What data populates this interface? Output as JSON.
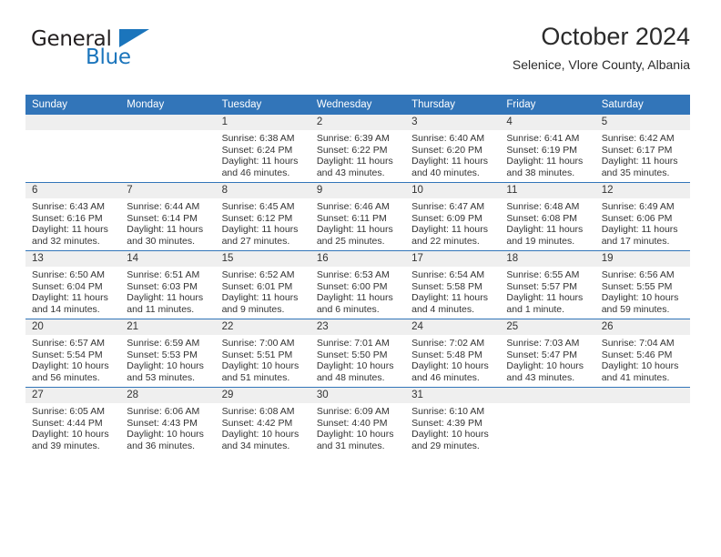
{
  "brand": {
    "name_dark": "General",
    "name_blue": "Blue",
    "accent_color": "#1b75bc"
  },
  "header": {
    "title": "October 2024",
    "subtitle": "Selenice, Vlore County, Albania"
  },
  "theme": {
    "header_row_bg": "#3275b9",
    "daynum_bg": "#efefef",
    "text": "#333333"
  },
  "calendar": {
    "weekday_headers": [
      "Sunday",
      "Monday",
      "Tuesday",
      "Wednesday",
      "Thursday",
      "Friday",
      "Saturday"
    ],
    "labels": {
      "sunrise": "Sunrise:",
      "sunset": "Sunset:",
      "daylight": "Daylight:"
    },
    "weeks": [
      [
        {
          "day": "",
          "empty": true
        },
        {
          "day": "",
          "empty": true
        },
        {
          "day": "1",
          "sunrise": "Sunrise: 6:38 AM",
          "sunset": "Sunset: 6:24 PM",
          "daylight": "Daylight: 11 hours and 46 minutes."
        },
        {
          "day": "2",
          "sunrise": "Sunrise: 6:39 AM",
          "sunset": "Sunset: 6:22 PM",
          "daylight": "Daylight: 11 hours and 43 minutes."
        },
        {
          "day": "3",
          "sunrise": "Sunrise: 6:40 AM",
          "sunset": "Sunset: 6:20 PM",
          "daylight": "Daylight: 11 hours and 40 minutes."
        },
        {
          "day": "4",
          "sunrise": "Sunrise: 6:41 AM",
          "sunset": "Sunset: 6:19 PM",
          "daylight": "Daylight: 11 hours and 38 minutes."
        },
        {
          "day": "5",
          "sunrise": "Sunrise: 6:42 AM",
          "sunset": "Sunset: 6:17 PM",
          "daylight": "Daylight: 11 hours and 35 minutes."
        }
      ],
      [
        {
          "day": "6",
          "sunrise": "Sunrise: 6:43 AM",
          "sunset": "Sunset: 6:16 PM",
          "daylight": "Daylight: 11 hours and 32 minutes."
        },
        {
          "day": "7",
          "sunrise": "Sunrise: 6:44 AM",
          "sunset": "Sunset: 6:14 PM",
          "daylight": "Daylight: 11 hours and 30 minutes."
        },
        {
          "day": "8",
          "sunrise": "Sunrise: 6:45 AM",
          "sunset": "Sunset: 6:12 PM",
          "daylight": "Daylight: 11 hours and 27 minutes."
        },
        {
          "day": "9",
          "sunrise": "Sunrise: 6:46 AM",
          "sunset": "Sunset: 6:11 PM",
          "daylight": "Daylight: 11 hours and 25 minutes."
        },
        {
          "day": "10",
          "sunrise": "Sunrise: 6:47 AM",
          "sunset": "Sunset: 6:09 PM",
          "daylight": "Daylight: 11 hours and 22 minutes."
        },
        {
          "day": "11",
          "sunrise": "Sunrise: 6:48 AM",
          "sunset": "Sunset: 6:08 PM",
          "daylight": "Daylight: 11 hours and 19 minutes."
        },
        {
          "day": "12",
          "sunrise": "Sunrise: 6:49 AM",
          "sunset": "Sunset: 6:06 PM",
          "daylight": "Daylight: 11 hours and 17 minutes."
        }
      ],
      [
        {
          "day": "13",
          "sunrise": "Sunrise: 6:50 AM",
          "sunset": "Sunset: 6:04 PM",
          "daylight": "Daylight: 11 hours and 14 minutes."
        },
        {
          "day": "14",
          "sunrise": "Sunrise: 6:51 AM",
          "sunset": "Sunset: 6:03 PM",
          "daylight": "Daylight: 11 hours and 11 minutes."
        },
        {
          "day": "15",
          "sunrise": "Sunrise: 6:52 AM",
          "sunset": "Sunset: 6:01 PM",
          "daylight": "Daylight: 11 hours and 9 minutes."
        },
        {
          "day": "16",
          "sunrise": "Sunrise: 6:53 AM",
          "sunset": "Sunset: 6:00 PM",
          "daylight": "Daylight: 11 hours and 6 minutes."
        },
        {
          "day": "17",
          "sunrise": "Sunrise: 6:54 AM",
          "sunset": "Sunset: 5:58 PM",
          "daylight": "Daylight: 11 hours and 4 minutes."
        },
        {
          "day": "18",
          "sunrise": "Sunrise: 6:55 AM",
          "sunset": "Sunset: 5:57 PM",
          "daylight": "Daylight: 11 hours and 1 minute."
        },
        {
          "day": "19",
          "sunrise": "Sunrise: 6:56 AM",
          "sunset": "Sunset: 5:55 PM",
          "daylight": "Daylight: 10 hours and 59 minutes."
        }
      ],
      [
        {
          "day": "20",
          "sunrise": "Sunrise: 6:57 AM",
          "sunset": "Sunset: 5:54 PM",
          "daylight": "Daylight: 10 hours and 56 minutes."
        },
        {
          "day": "21",
          "sunrise": "Sunrise: 6:59 AM",
          "sunset": "Sunset: 5:53 PM",
          "daylight": "Daylight: 10 hours and 53 minutes."
        },
        {
          "day": "22",
          "sunrise": "Sunrise: 7:00 AM",
          "sunset": "Sunset: 5:51 PM",
          "daylight": "Daylight: 10 hours and 51 minutes."
        },
        {
          "day": "23",
          "sunrise": "Sunrise: 7:01 AM",
          "sunset": "Sunset: 5:50 PM",
          "daylight": "Daylight: 10 hours and 48 minutes."
        },
        {
          "day": "24",
          "sunrise": "Sunrise: 7:02 AM",
          "sunset": "Sunset: 5:48 PM",
          "daylight": "Daylight: 10 hours and 46 minutes."
        },
        {
          "day": "25",
          "sunrise": "Sunrise: 7:03 AM",
          "sunset": "Sunset: 5:47 PM",
          "daylight": "Daylight: 10 hours and 43 minutes."
        },
        {
          "day": "26",
          "sunrise": "Sunrise: 7:04 AM",
          "sunset": "Sunset: 5:46 PM",
          "daylight": "Daylight: 10 hours and 41 minutes."
        }
      ],
      [
        {
          "day": "27",
          "sunrise": "Sunrise: 6:05 AM",
          "sunset": "Sunset: 4:44 PM",
          "daylight": "Daylight: 10 hours and 39 minutes."
        },
        {
          "day": "28",
          "sunrise": "Sunrise: 6:06 AM",
          "sunset": "Sunset: 4:43 PM",
          "daylight": "Daylight: 10 hours and 36 minutes."
        },
        {
          "day": "29",
          "sunrise": "Sunrise: 6:08 AM",
          "sunset": "Sunset: 4:42 PM",
          "daylight": "Daylight: 10 hours and 34 minutes."
        },
        {
          "day": "30",
          "sunrise": "Sunrise: 6:09 AM",
          "sunset": "Sunset: 4:40 PM",
          "daylight": "Daylight: 10 hours and 31 minutes."
        },
        {
          "day": "31",
          "sunrise": "Sunrise: 6:10 AM",
          "sunset": "Sunset: 4:39 PM",
          "daylight": "Daylight: 10 hours and 29 minutes."
        },
        {
          "day": "",
          "empty": true
        },
        {
          "day": "",
          "empty": true
        }
      ]
    ]
  }
}
